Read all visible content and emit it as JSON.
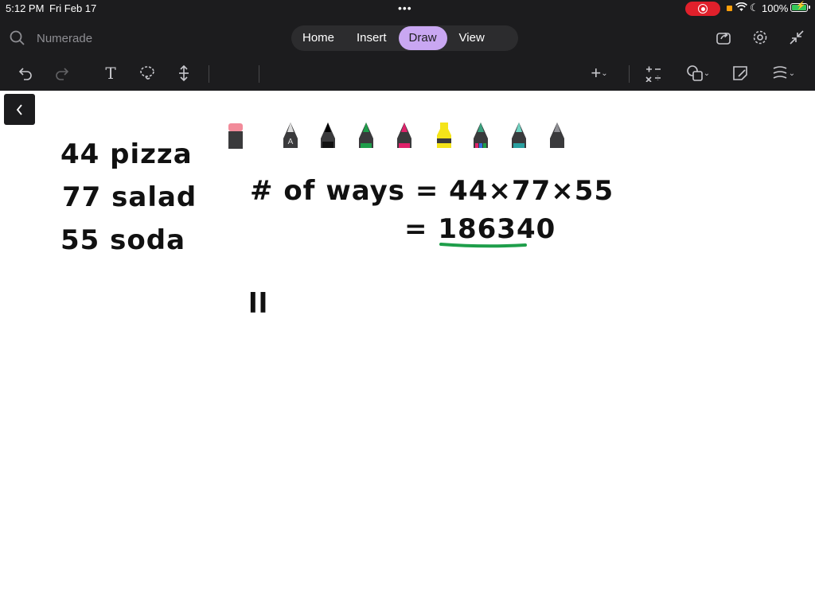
{
  "status_bar": {
    "time": "5:12 PM",
    "date": "Fri Feb 17",
    "battery": "100%",
    "menu_dots": "•••"
  },
  "search": {
    "placeholder": "Numerade"
  },
  "tabs": [
    {
      "label": "Home",
      "active": false
    },
    {
      "label": "Insert",
      "active": false
    },
    {
      "label": "Draw",
      "active": true
    },
    {
      "label": "View",
      "active": false
    }
  ],
  "canvas": {
    "items": [
      {
        "text": "44 pizza"
      },
      {
        "text": "77 salad"
      },
      {
        "text": "55 soda"
      }
    ],
    "equation_line1": "# of ways = 44×77×55",
    "equation_line2_prefix": "= ",
    "equation_result": "186340",
    "stray_mark": "ll",
    "underline_color": "#1e9e4a"
  },
  "colors": {
    "toolbar_bg": "#1c1c1e",
    "active_tab": "#c9a7f2",
    "record": "#e0202b",
    "battery": "#34c759"
  },
  "tools": {
    "undo": "undo-icon",
    "redo": "redo-icon",
    "text": "T",
    "lasso": "lasso-icon",
    "space": "insert-space-icon",
    "eraser": "eraser-icon",
    "add": "+",
    "math": "math-icon",
    "shapes": "shapes-icon",
    "sticky": "sticky-note-icon",
    "ink_to_text": "ink-to-shape-icon"
  }
}
